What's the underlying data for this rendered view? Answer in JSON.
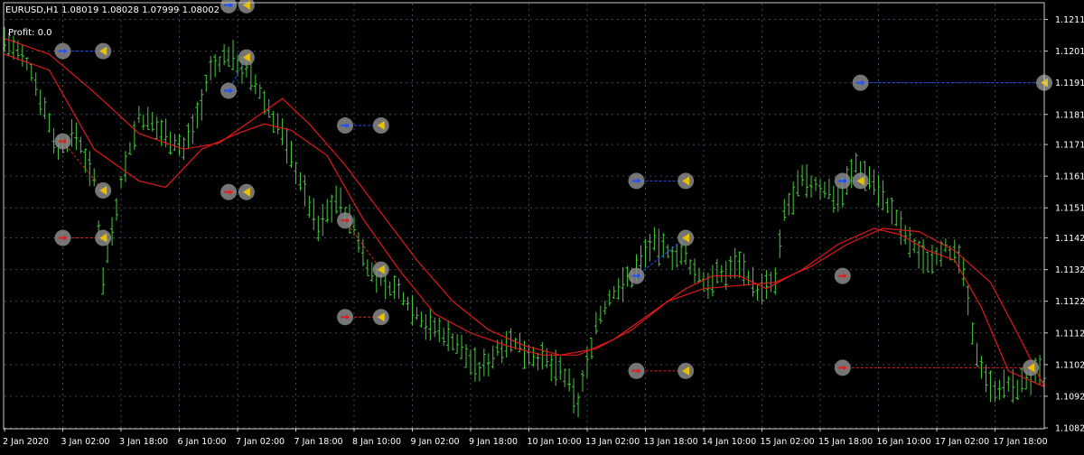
{
  "header": {
    "symbol": "EURUSD,H1",
    "ohlc": "1.08019 1.08028 1.07999 1.08002",
    "profit_label": "Profit: 0.0"
  },
  "colors": {
    "background": "#000000",
    "grid": "#3a4a58",
    "bars": "#44cc3c",
    "ma": "#e01818",
    "buy_line": "#2050ff",
    "sell_line": "#e02020",
    "marker_circle": "#8a8a8a",
    "close_marker": "#e8c000"
  },
  "chart_data": {
    "type": "bar",
    "symbol": "EURUSD",
    "timeframe": "H1",
    "grid": true,
    "ylim": [
      1.1082,
      1.1216
    ],
    "yticks": [
      "1.12110",
      "1.12010",
      "1.11910",
      "1.11810",
      "1.11715",
      "1.11615",
      "1.11515",
      "1.11420",
      "1.11320",
      "1.11220",
      "1.11120",
      "1.11020",
      "1.10920",
      "1.10820"
    ],
    "ytick_values": [
      1.1211,
      1.1201,
      1.1191,
      1.1181,
      1.11715,
      1.11615,
      1.11515,
      1.1142,
      1.1132,
      1.1122,
      1.1112,
      1.1102,
      1.1092,
      1.1082
    ],
    "xticks": [
      "2 Jan 2020",
      "3 Jan 02:00",
      "3 Jan 18:00",
      "6 Jan 10:00",
      "7 Jan 02:00",
      "7 Jan 18:00",
      "8 Jan 10:00",
      "9 Jan 02:00",
      "9 Jan 18:00",
      "10 Jan 10:00",
      "13 Jan 02:00",
      "13 Jan 18:00",
      "14 Jan 10:00",
      "15 Jan 02:00",
      "15 Jan 18:00",
      "16 Jan 10:00",
      "17 Jan 02:00",
      "17 Jan 18:00"
    ],
    "xrange": [
      0,
      232
    ],
    "xtick_positions": [
      0,
      16,
      32,
      48,
      64,
      80,
      96,
      112,
      128,
      144,
      160,
      176,
      192,
      208,
      224,
      240,
      256,
      272
    ],
    "price_keypoints": [
      [
        0,
        1.1205
      ],
      [
        6,
        1.1195
      ],
      [
        12,
        1.117
      ],
      [
        16,
        1.1175
      ],
      [
        20,
        1.116
      ],
      [
        22,
        1.113
      ],
      [
        26,
        1.116
      ],
      [
        30,
        1.118
      ],
      [
        36,
        1.1175
      ],
      [
        40,
        1.117
      ],
      [
        44,
        1.1185
      ],
      [
        46,
        1.1195
      ],
      [
        50,
        1.12
      ],
      [
        54,
        1.1195
      ],
      [
        58,
        1.1185
      ],
      [
        62,
        1.1175
      ],
      [
        66,
        1.116
      ],
      [
        70,
        1.1145
      ],
      [
        74,
        1.1155
      ],
      [
        78,
        1.1145
      ],
      [
        82,
        1.113
      ],
      [
        88,
        1.1125
      ],
      [
        94,
        1.1115
      ],
      [
        100,
        1.111
      ],
      [
        106,
        1.11
      ],
      [
        112,
        1.111
      ],
      [
        118,
        1.1105
      ],
      [
        124,
        1.11
      ],
      [
        128,
        1.109
      ],
      [
        132,
        1.1115
      ],
      [
        136,
        1.1125
      ],
      [
        140,
        1.113
      ],
      [
        144,
        1.114
      ],
      [
        148,
        1.1138
      ],
      [
        152,
        1.1135
      ],
      [
        156,
        1.1128
      ],
      [
        160,
        1.113
      ],
      [
        164,
        1.1135
      ],
      [
        168,
        1.1125
      ],
      [
        172,
        1.1128
      ],
      [
        174,
        1.115
      ],
      [
        178,
        1.116
      ],
      [
        182,
        1.1158
      ],
      [
        186,
        1.1155
      ],
      [
        190,
        1.1165
      ],
      [
        194,
        1.116
      ],
      [
        198,
        1.115
      ],
      [
        202,
        1.114
      ],
      [
        206,
        1.1135
      ],
      [
        210,
        1.114
      ],
      [
        214,
        1.1132
      ],
      [
        216,
        1.111
      ],
      [
        220,
        1.1095
      ],
      [
        226,
        1.1095
      ],
      [
        232,
        1.11
      ]
    ],
    "series": [
      {
        "type": "line",
        "points": [
          [
            0,
            1.1205
          ],
          [
            10,
            1.12
          ],
          [
            20,
            1.1188
          ],
          [
            30,
            1.1175
          ],
          [
            40,
            1.117
          ],
          [
            48,
            1.1172
          ],
          [
            56,
            1.118
          ],
          [
            62,
            1.1186
          ],
          [
            68,
            1.1178
          ],
          [
            76,
            1.1165
          ],
          [
            84,
            1.115
          ],
          [
            92,
            1.1135
          ],
          [
            100,
            1.1122
          ],
          [
            108,
            1.1113
          ],
          [
            116,
            1.1108
          ],
          [
            124,
            1.1105
          ],
          [
            132,
            1.1107
          ],
          [
            140,
            1.1113
          ],
          [
            148,
            1.1122
          ],
          [
            156,
            1.1126
          ],
          [
            164,
            1.1127
          ],
          [
            172,
            1.1128
          ],
          [
            180,
            1.1133
          ],
          [
            188,
            1.114
          ],
          [
            196,
            1.1145
          ],
          [
            204,
            1.1144
          ],
          [
            212,
            1.1138
          ],
          [
            220,
            1.1128
          ],
          [
            226,
            1.1112
          ],
          [
            232,
            1.1095
          ]
        ]
      },
      {
        "type": "line",
        "points": [
          [
            0,
            1.12
          ],
          [
            10,
            1.1195
          ],
          [
            20,
            1.117
          ],
          [
            30,
            1.116
          ],
          [
            36,
            1.1158
          ],
          [
            44,
            1.117
          ],
          [
            52,
            1.1175
          ],
          [
            58,
            1.1178
          ],
          [
            64,
            1.1176
          ],
          [
            72,
            1.1168
          ],
          [
            80,
            1.1148
          ],
          [
            88,
            1.1132
          ],
          [
            96,
            1.1118
          ],
          [
            104,
            1.1112
          ],
          [
            112,
            1.1108
          ],
          [
            120,
            1.1105
          ],
          [
            128,
            1.1105
          ],
          [
            136,
            1.111
          ],
          [
            144,
            1.1118
          ],
          [
            152,
            1.1126
          ],
          [
            158,
            1.113
          ],
          [
            164,
            1.113
          ],
          [
            170,
            1.1126
          ],
          [
            178,
            1.1132
          ],
          [
            186,
            1.114
          ],
          [
            194,
            1.1145
          ],
          [
            200,
            1.1143
          ],
          [
            206,
            1.1138
          ],
          [
            212,
            1.1135
          ],
          [
            218,
            1.112
          ],
          [
            224,
            1.11
          ],
          [
            232,
            1.1095
          ]
        ]
      }
    ],
    "trade_markers": [
      {
        "side": "buy",
        "x": 13,
        "y": 1.1201,
        "close_x": 22,
        "close_y": 1.1201
      },
      {
        "side": "sell",
        "x": 13,
        "y": 1.11725,
        "close_x": 22,
        "close_y": 1.1157
      },
      {
        "side": "sell",
        "x": 13,
        "y": 1.1142,
        "close_x": 22,
        "close_y": 1.1142
      },
      {
        "side": "buy",
        "x": 50,
        "y": 1.12155,
        "close_x": 54,
        "close_y": 1.12155
      },
      {
        "side": "buy",
        "x": 50,
        "y": 1.11885,
        "close_x": 54,
        "close_y": 1.1199
      },
      {
        "side": "sell",
        "x": 50,
        "y": 1.11565,
        "close_x": 54,
        "close_y": 1.11565
      },
      {
        "side": "buy",
        "x": 76,
        "y": 1.11775,
        "close_x": 84,
        "close_y": 1.11775
      },
      {
        "side": "sell",
        "x": 76,
        "y": 1.11475,
        "close_x": 84,
        "close_y": 1.1132
      },
      {
        "side": "sell",
        "x": 76,
        "y": 1.1117,
        "close_x": 84,
        "close_y": 1.1117
      },
      {
        "side": "buy",
        "x": 141,
        "y": 1.116,
        "close_x": 152,
        "close_y": 1.116
      },
      {
        "side": "buy",
        "x": 141,
        "y": 1.113,
        "close_x": 152,
        "close_y": 1.1142
      },
      {
        "side": "sell",
        "x": 141,
        "y": 1.11,
        "close_x": 152,
        "close_y": 1.11
      },
      {
        "side": "buy",
        "x": 187,
        "y": 1.116,
        "close_x": 191,
        "close_y": 1.116
      },
      {
        "side": "sell",
        "x": 187,
        "y": 1.113,
        "close_x": 187,
        "close_y": 1.113
      },
      {
        "side": "sell",
        "x": 187,
        "y": 1.1101,
        "close_x": 229,
        "close_y": 1.1101
      },
      {
        "side": "buy",
        "x": 191,
        "y": 1.1191,
        "close_x": 232,
        "close_y": 1.1191
      }
    ]
  }
}
